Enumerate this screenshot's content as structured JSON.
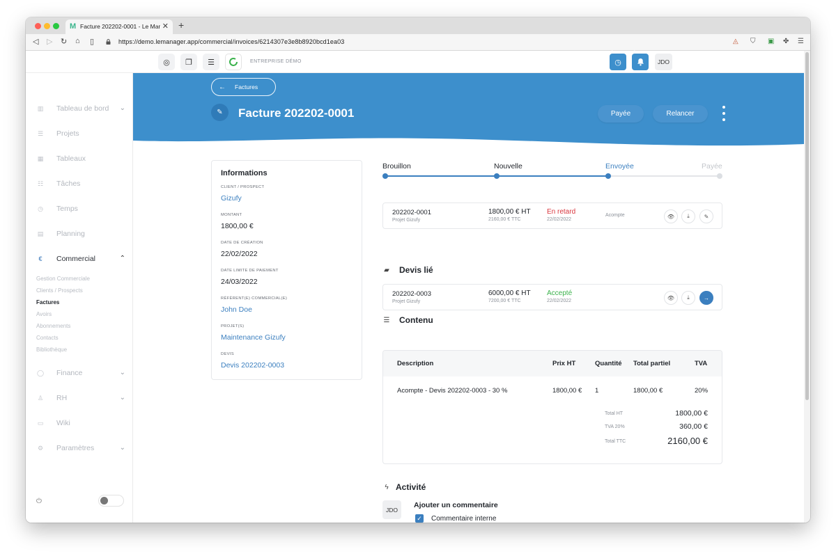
{
  "browser": {
    "tab_title": "Facture 202202-0001 - Le Man",
    "url": "https://demo.lemanager.app/commercial/invoices/6214307e3e8b8920bcd1ea03"
  },
  "topbar": {
    "company": "ENTREPRISE DÉMO",
    "clock_count": "0",
    "bell_count": "0",
    "user_initials": "JDO"
  },
  "sidebar": {
    "items": [
      {
        "label": "Tableau de bord",
        "icon": "dashboard-icon"
      },
      {
        "label": "Projets",
        "icon": "list-icon"
      },
      {
        "label": "Tableaux",
        "icon": "grid-icon"
      },
      {
        "label": "Tâches",
        "icon": "tasks-icon"
      },
      {
        "label": "Temps",
        "icon": "clock-icon"
      },
      {
        "label": "Planning",
        "icon": "calendar-icon"
      },
      {
        "label": "Commercial",
        "icon": "euro-icon"
      },
      {
        "label": "Finance",
        "icon": "finance-icon"
      },
      {
        "label": "RH",
        "icon": "user-icon"
      },
      {
        "label": "Wiki",
        "icon": "wiki-icon"
      },
      {
        "label": "Paramètres",
        "icon": "gear-icon"
      }
    ],
    "commercial_sub": [
      "Gestion Commerciale",
      "Clients / Prospects",
      "Factures",
      "Avoirs",
      "Abonnements",
      "Contacts",
      "Bibliothèque"
    ]
  },
  "header": {
    "back_label": "Factures",
    "title": "Facture 202202-0001",
    "btn_paid": "Payée",
    "btn_remind": "Relancer"
  },
  "info": {
    "title": "Informations",
    "client_label": "CLIENT / PROSPECT",
    "client": "Gizufy",
    "amount_label": "MONTANT",
    "amount": "1800,00 €",
    "created_label": "DATE DE CRÉATION",
    "created": "22/02/2022",
    "due_label": "DATE LIMITE DE PAIEMENT",
    "due": "24/03/2022",
    "referent_label": "RÉFÉRENT(E) COMMERCIAL(E)",
    "referent": "John Doe",
    "projects_label": "PROJET(S)",
    "project": "Maintenance Gizufy",
    "quote_label": "DEVIS",
    "quote": "Devis 202202-0003"
  },
  "steps": [
    "Brouillon",
    "Nouvelle",
    "Envoyée",
    "Payée"
  ],
  "invoice_row": {
    "number": "202202-0001",
    "project": "Projet Gizufy",
    "ht": "1800,00 € HT",
    "ttc": "2160,00 € TTC",
    "status": "En retard",
    "date": "22/02/2022",
    "type": "Acompte"
  },
  "linked_quote": {
    "section_title": "Devis lié",
    "number": "202202-0003",
    "project": "Projet Gizufy",
    "ht": "6000,00 € HT",
    "ttc": "7200,00 € TTC",
    "status": "Accepté",
    "date": "22/02/2022"
  },
  "content": {
    "section_title": "Contenu",
    "columns": [
      "Description",
      "Prix HT",
      "Quantité",
      "Total partiel",
      "TVA"
    ],
    "rows": [
      {
        "description": "Acompte - Devis 202202-0003 - 30 %",
        "price": "1800,00 €",
        "qty": "1",
        "total": "1800,00 €",
        "vat": "20%"
      }
    ],
    "total_ht_label": "Total HT",
    "total_ht": "1800,00 €",
    "vat_label": "TVA 20%",
    "vat": "360,00 €",
    "total_ttc_label": "Total TTC",
    "total_ttc": "2160,00 €"
  },
  "activity": {
    "section_title": "Activité",
    "avatar": "JDO",
    "add_comment": "Ajouter un commentaire",
    "internal_label": "Commentaire interne"
  },
  "colors": {
    "primary": "#3b7fbf",
    "banner": "#3d8fcc",
    "late": "#d9363e",
    "accepted": "#3bb24c"
  }
}
